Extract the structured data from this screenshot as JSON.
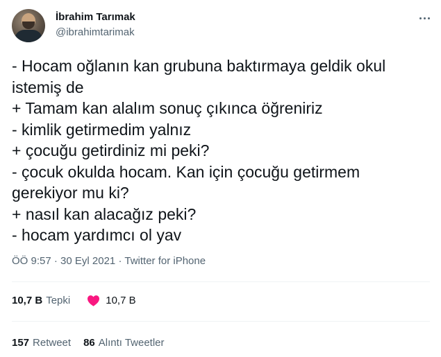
{
  "user": {
    "display_name": "İbrahim Tarımak",
    "handle": "@ibrahimtarimak"
  },
  "tweet": {
    "lines": [
      "- Hocam oğlanın kan grubuna baktırmaya geldik okul",
      "istemiş de",
      "+ Tamam kan alalım sonuç çıkınca öğreniriz",
      "- kimlik getirmedim yalnız",
      "+ çocuğu getirdiniz mi peki?",
      "- çocuk okulda hocam. Kan için çocuğu getirmem",
      "gerekiyor mu ki?",
      "+ nasıl kan alacağız peki?",
      "- hocam yardımcı ol yav"
    ]
  },
  "meta": {
    "time": "ÖÖ 9:57",
    "separator": "·",
    "date": "30 Eyl 2021",
    "source": "Twitter for iPhone"
  },
  "stats": {
    "reactions_count": "10,7 B",
    "reactions_label": "Tepki",
    "likes_count": "10,7 B",
    "retweets_count": "157",
    "retweets_label": "Retweet",
    "quotes_count": "86",
    "quotes_label": "Alıntı Tweetler"
  },
  "icons": {
    "more": "more-icon",
    "heart": "heart-icon"
  },
  "colors": {
    "heart": "#f91880",
    "secondary_text": "#536471"
  }
}
